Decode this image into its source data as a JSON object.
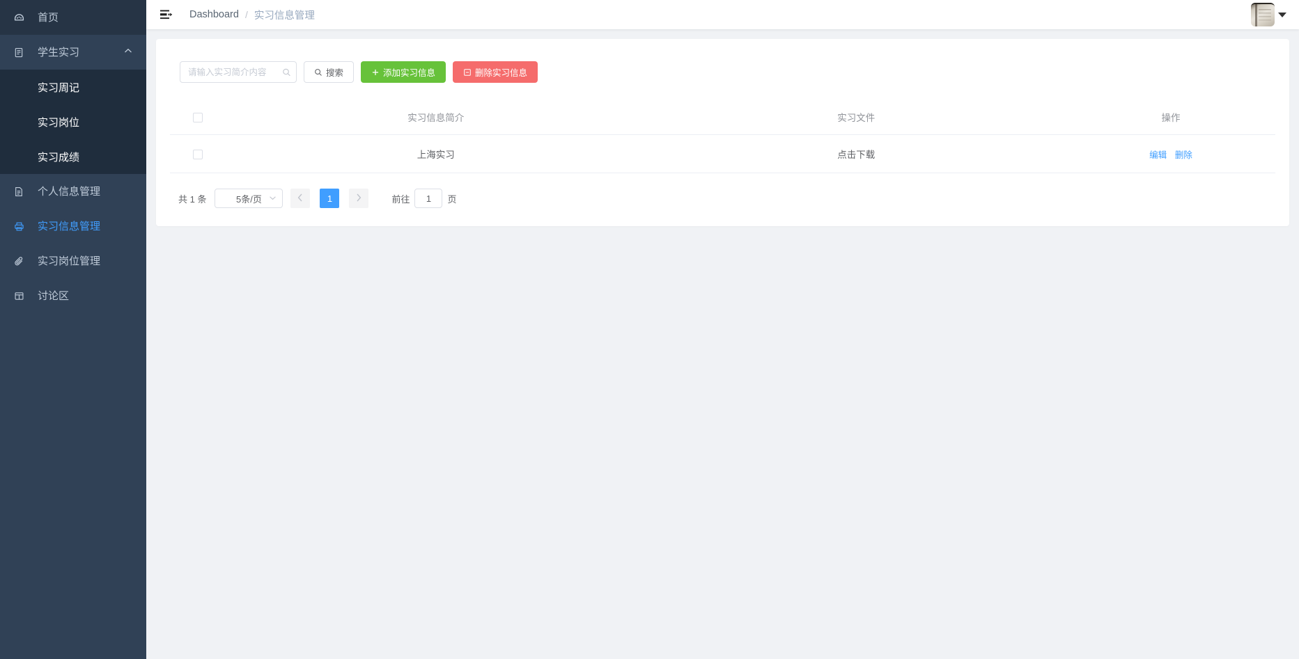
{
  "sidebar": {
    "items": [
      {
        "label": "首页",
        "icon": "dashboard-icon",
        "state": "normal"
      },
      {
        "label": "学生实习",
        "icon": "document-icon",
        "state": "expanded",
        "caret": "chevron-up-icon"
      },
      {
        "label": "个人信息管理",
        "icon": "document-icon",
        "state": "normal"
      },
      {
        "label": "实习信息管理",
        "icon": "printer-icon",
        "state": "active"
      },
      {
        "label": "实习岗位管理",
        "icon": "paperclip-icon",
        "state": "normal"
      },
      {
        "label": "讨论区",
        "icon": "form-icon",
        "state": "normal"
      }
    ],
    "submenu": [
      {
        "label": "实习周记"
      },
      {
        "label": "实习岗位"
      },
      {
        "label": "实习成绩"
      }
    ],
    "colors": {
      "bg": "#304156",
      "submenu_bg": "#1f2d3d",
      "text": "#bfcbd9",
      "active": "#409eff"
    }
  },
  "header": {
    "menu_toggle_icon": "collapse-sidebar-icon",
    "breadcrumb": {
      "root": "Dashboard",
      "separator": "/",
      "current": "实习信息管理"
    },
    "avatar_caret_icon": "caret-down-icon"
  },
  "toolbar": {
    "search_placeholder": "请输入实习简介内容",
    "search_value": "",
    "search_icon": "search-icon",
    "search_button_label": "搜索",
    "search_button_icon": "search-icon",
    "add_button_label": "添加实习信息",
    "add_button_icon": "plus-icon",
    "delete_button_label": "删除实习信息",
    "delete_button_icon": "delete-box-icon",
    "colors": {
      "add": "#67c23a",
      "delete": "#f56c6c"
    }
  },
  "table": {
    "headers": [
      "",
      "实习信息简介",
      "实习文件",
      "操作"
    ],
    "rows": [
      {
        "checked": false,
        "brief": "上海实习",
        "file_label": "点击下载",
        "actions": [
          "编辑",
          "删除"
        ]
      }
    ]
  },
  "pagination": {
    "total_text": "共 1 条",
    "page_size_value": "5条/页",
    "prev_icon": "chevron-left-icon",
    "next_icon": "chevron-right-icon",
    "pages": [
      "1"
    ],
    "current_page": "1",
    "goto_label": "前往",
    "goto_value": "1",
    "goto_suffix": "页"
  }
}
